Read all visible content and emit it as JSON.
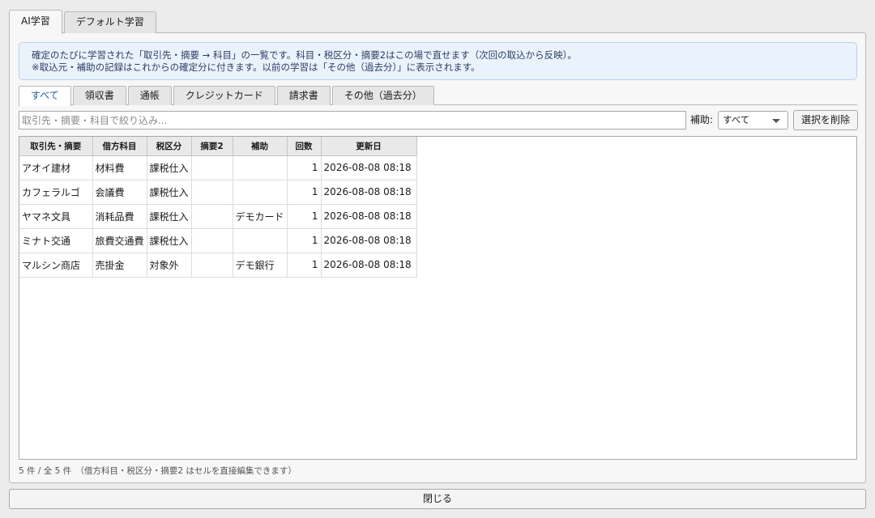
{
  "top_tabs": [
    {
      "label": "AI学習",
      "active": true
    },
    {
      "label": "デフォルト学習",
      "active": false
    }
  ],
  "info": {
    "line1": "確定のたびに学習された「取引先・摘要 → 科目」の一覧です。科目・税区分・摘要2はこの場で直せます（次回の取込から反映）。",
    "line2": "※取込元・補助の記録はこれからの確定分に付きます。以前の学習は「その他（過去分）」に表示されます。"
  },
  "sub_tabs": [
    {
      "label": "すべて",
      "active": true
    },
    {
      "label": "領収書",
      "active": false
    },
    {
      "label": "通帳",
      "active": false
    },
    {
      "label": "クレジットカード",
      "active": false
    },
    {
      "label": "請求書",
      "active": false
    },
    {
      "label": "その他（過去分）",
      "active": false
    }
  ],
  "filter": {
    "search_placeholder": "取引先・摘要・科目で絞り込み...",
    "aux_label": "補助:",
    "aux_selected": "すべて",
    "delete_label": "選択を削除"
  },
  "table": {
    "columns": [
      "取引先・摘要",
      "借方科目",
      "税区分",
      "摘要2",
      "補助",
      "回数",
      "更新日"
    ],
    "rows": [
      [
        "アオイ建材",
        "材料費",
        "課税仕入",
        "",
        "",
        "1",
        "2026-08-08 08:18"
      ],
      [
        "カフェラルゴ",
        "会議費",
        "課税仕入",
        "",
        "",
        "1",
        "2026-08-08 08:18"
      ],
      [
        "ヤマネ文具",
        "消耗品費",
        "課税仕入",
        "",
        "デモカード",
        "1",
        "2026-08-08 08:18"
      ],
      [
        "ミナト交通",
        "旅費交通費",
        "課税仕入",
        "",
        "",
        "1",
        "2026-08-08 08:18"
      ],
      [
        "マルシン商店",
        "売掛金",
        "対象外",
        "",
        "デモ銀行",
        "1",
        "2026-08-08 08:18"
      ]
    ]
  },
  "status": "5 件 / 全 5 件　（借方科目・税区分・摘要2 はセルを直接編集できます）",
  "close_label": "閉じる"
}
